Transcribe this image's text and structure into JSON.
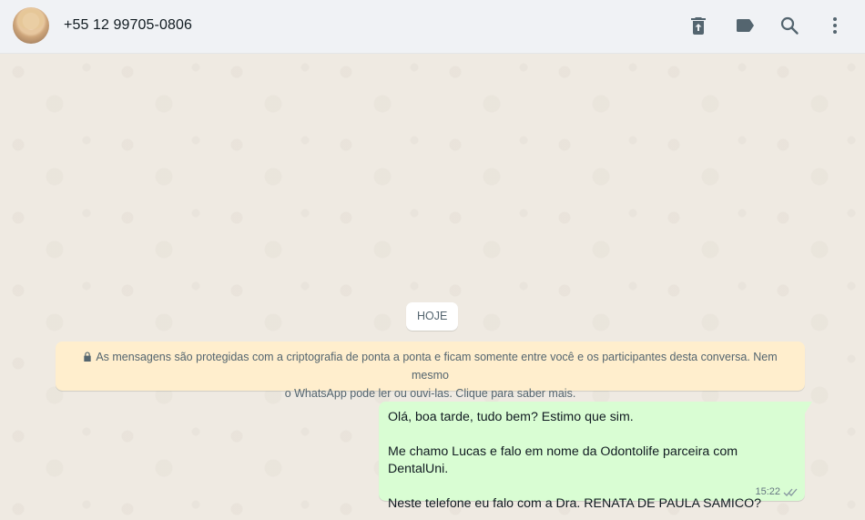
{
  "header": {
    "contact_name": "+55 12 99705-0806",
    "icons": [
      "delete-icon",
      "label-icon",
      "search-icon",
      "menu-icon"
    ]
  },
  "chat": {
    "date_chip": "HOJE",
    "encryption_notice": {
      "icon": "lock-icon",
      "line1": "As mensagens são protegidas com a criptografia de ponta a ponta e ficam somente entre você e os participantes desta conversa. Nem mesmo",
      "line2": "o WhatsApp pode ler ou ouvi-las. Clique para saber mais."
    },
    "messages": [
      {
        "direction": "outgoing",
        "lines": [
          "Olá, boa tarde, tudo bem? Estimo que sim.",
          "",
          "Me chamo Lucas e falo em nome da Odontolife parceira com DentalUni.",
          "",
          "Neste telefone eu falo com a Dra. RENATA DE PAULA SAMICO?"
        ],
        "time": "15:22",
        "status_icon": "double-check-icon"
      }
    ]
  },
  "colors": {
    "header_bg": "#f0f2f5",
    "chat_bg": "#efeae2",
    "outgoing_bubble": "#d9fdd3",
    "notice_bg": "#ffeecd",
    "icon_color": "#54656f"
  }
}
